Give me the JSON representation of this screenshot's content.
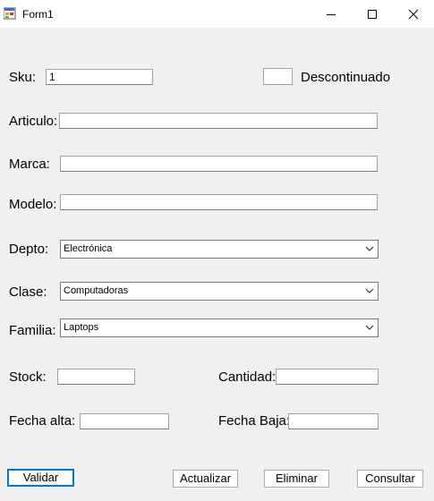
{
  "window": {
    "title": "Form1"
  },
  "form": {
    "sku": {
      "label": "Sku:",
      "value": "1"
    },
    "descontinuado": {
      "label": "Descontinuado"
    },
    "articulo": {
      "label": "Articulo:",
      "value": ""
    },
    "marca": {
      "label": "Marca:",
      "value": ""
    },
    "modelo": {
      "label": "Modelo:",
      "value": ""
    },
    "depto": {
      "label": "Depto:",
      "value": "Electrónica"
    },
    "clase": {
      "label": "Clase:",
      "value": "Computadoras"
    },
    "familia": {
      "label": "Familia:",
      "value": "Laptops"
    },
    "stock": {
      "label": "Stock:",
      "value": ""
    },
    "cantidad": {
      "label": "Cantidad:",
      "value": ""
    },
    "fecha_alta": {
      "label": "Fecha alta:",
      "value": ""
    },
    "fecha_baja": {
      "label": "Fecha Baja:",
      "value": ""
    }
  },
  "buttons": {
    "validar": "Validar",
    "actualizar": "Actualizar",
    "eliminar": "Eliminar",
    "consultar": "Consultar"
  },
  "icons": {
    "app": "form-app-icon",
    "minimize": "minimize-icon",
    "maximize": "maximize-icon",
    "close": "close-icon",
    "dropdown": "chevron-down-icon"
  }
}
